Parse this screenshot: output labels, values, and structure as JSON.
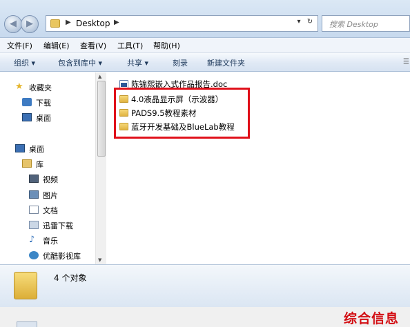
{
  "address_bar": {
    "path": "Desktop",
    "search_placeholder": "搜索 Desktop"
  },
  "menu": [
    "文件(F)",
    "编辑(E)",
    "查看(V)",
    "工具(T)",
    "帮助(H)"
  ],
  "toolbar": [
    "组织 ▾",
    "包含到库中 ▾",
    "共享 ▾",
    "刻录",
    "新建文件夹"
  ],
  "sidebar": {
    "favorites": "收藏夹",
    "downloads": "下载",
    "desktop_fav": "桌面",
    "desktop": "桌面",
    "libraries": "库",
    "video": "视频",
    "pictures": "图片",
    "documents": "文档",
    "xunlei": "迅雷下载",
    "music": "音乐",
    "youku": "优酷影视库"
  },
  "files": [
    {
      "name": "陈锦熙嵌入式作品报告.doc",
      "type": "doc"
    },
    {
      "name": "4.0液晶显示屏（示波器）",
      "type": "folder"
    },
    {
      "name": "PADS9.5教程素材",
      "type": "folder"
    },
    {
      "name": "蓝牙开发基础及BlueLab教程",
      "type": "folder"
    }
  ],
  "details": {
    "count": "4 个对象"
  },
  "watermark": "综合信息",
  "colors": {
    "highlight_border": "#e0101a",
    "watermark": "#d30f14"
  }
}
